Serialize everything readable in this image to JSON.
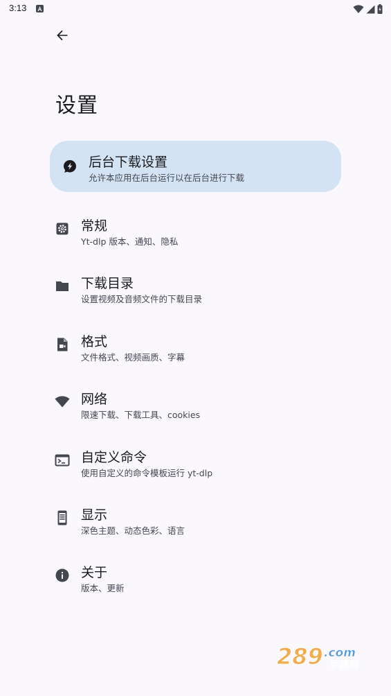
{
  "status_bar": {
    "time": "3:13"
  },
  "header": {
    "title": "设置"
  },
  "settings": [
    {
      "title": "后台下载设置",
      "subtitle": "允许本应用在后台运行以在后台进行下载",
      "icon": "bolt-chat-icon"
    },
    {
      "title": "常规",
      "subtitle": "Yt-dlp 版本、通知、隐私",
      "icon": "settings-gear-icon"
    },
    {
      "title": "下载目录",
      "subtitle": "设置视频及音频文件的下载目录",
      "icon": "folder-icon"
    },
    {
      "title": "格式",
      "subtitle": "文件格式、视频画质、字幕",
      "icon": "video-file-icon"
    },
    {
      "title": "网络",
      "subtitle": "限速下载、下载工具、cookies",
      "icon": "wifi-icon"
    },
    {
      "title": "自定义命令",
      "subtitle": "使用自定义的命令模板运行 yt-dlp",
      "icon": "terminal-icon"
    },
    {
      "title": "显示",
      "subtitle": "深色主题、动态色彩、语言",
      "icon": "phone-display-icon"
    },
    {
      "title": "关于",
      "subtitle": "版本、更新",
      "icon": "info-icon"
    }
  ],
  "watermark": {
    "text": "289.com 手游网"
  },
  "colors": {
    "background": "#faf8fd",
    "highlight": "#d4e3f4",
    "icon": "#44474e"
  }
}
